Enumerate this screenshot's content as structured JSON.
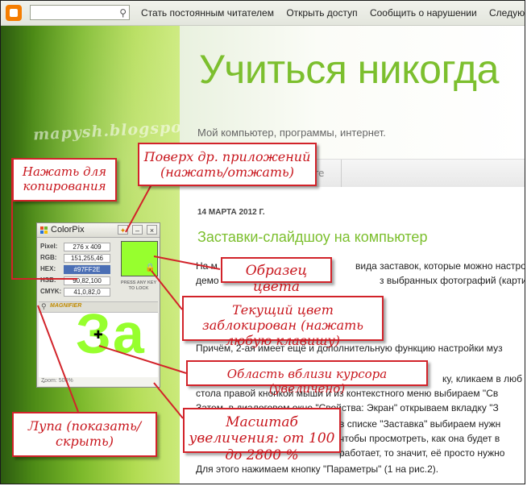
{
  "navbar": {
    "links": [
      "Стать постоянным читателем",
      "Открыть доступ",
      "Сообщить о нарушении",
      "Следующий б"
    ]
  },
  "blog": {
    "title": "Учиться никогда",
    "description": "Мой компьютер, программы, интернет.",
    "tab_more": "ore",
    "watermark": "mapysh.blogspot.com"
  },
  "post": {
    "date": "14 МАРТА 2012 Г.",
    "title": "Заставки-слайдшоу на компьютер",
    "lines": [
      "На м",
      "демо",
      "Причём, 2-ая имеет ещё и дополнительную функцию настройки муз",
      "ку, кликаем в люб",
      "стола правой кнопкой мыши и из контекстного меню выбираем \"Св",
      "Затем, в диалоговом окне \"Свойства: Экран\" открываем вкладку \"З",
      "в списке \"Заставка\" выбираем нужн",
      "чтобы просмотреть, как она будет в",
      "работает, то значит, её просто нужно",
      "Для этого нажимаем кнопку \"Параметры\" (1 на рис.2)."
    ],
    "line2_tail_a": "вида заставок, которые можно настро",
    "line2_tail_b": "з выбранных фотографий (картинок)"
  },
  "colorpix": {
    "title": "ColorPix",
    "pixel_label": "Pixel:",
    "pixel_value": "276 x 409",
    "rgb_label": "RGB:",
    "rgb_value": "151,255,46",
    "hex_label": "HEX:",
    "hex_value": "#97FF2E",
    "hsb_label": "HSB:",
    "hsb_value": "90,82,100",
    "cmyk_label": "CMYK:",
    "cmyk_value": "41,0,82,0",
    "press_text": "PRESS ANY KEY TO LOCK",
    "magnifier_label": "MAGNIFIER",
    "zoom_text": "Zoom: 500%",
    "magnified_text": "За",
    "swatch_color": "#97ff2e"
  },
  "callouts": {
    "copy": "Нажать для копирования",
    "ontop": "Поверх др. приложений (нажать/отжать)",
    "sample": "Образец цвета",
    "locked": "Текущий цвет заблокирован (нажать любую клавишу)",
    "cursor_area": "Область вблизи курсора (увеличено)",
    "magnifier": "Лупа (показать/скрыть)",
    "zoom_scale": "Масштаб увеличения: от 100 до 2800 %"
  },
  "colors": {
    "accent_green": "#7cbf2e",
    "callout_red": "#c8161d",
    "hex_highlight": "#4b6fb5"
  }
}
